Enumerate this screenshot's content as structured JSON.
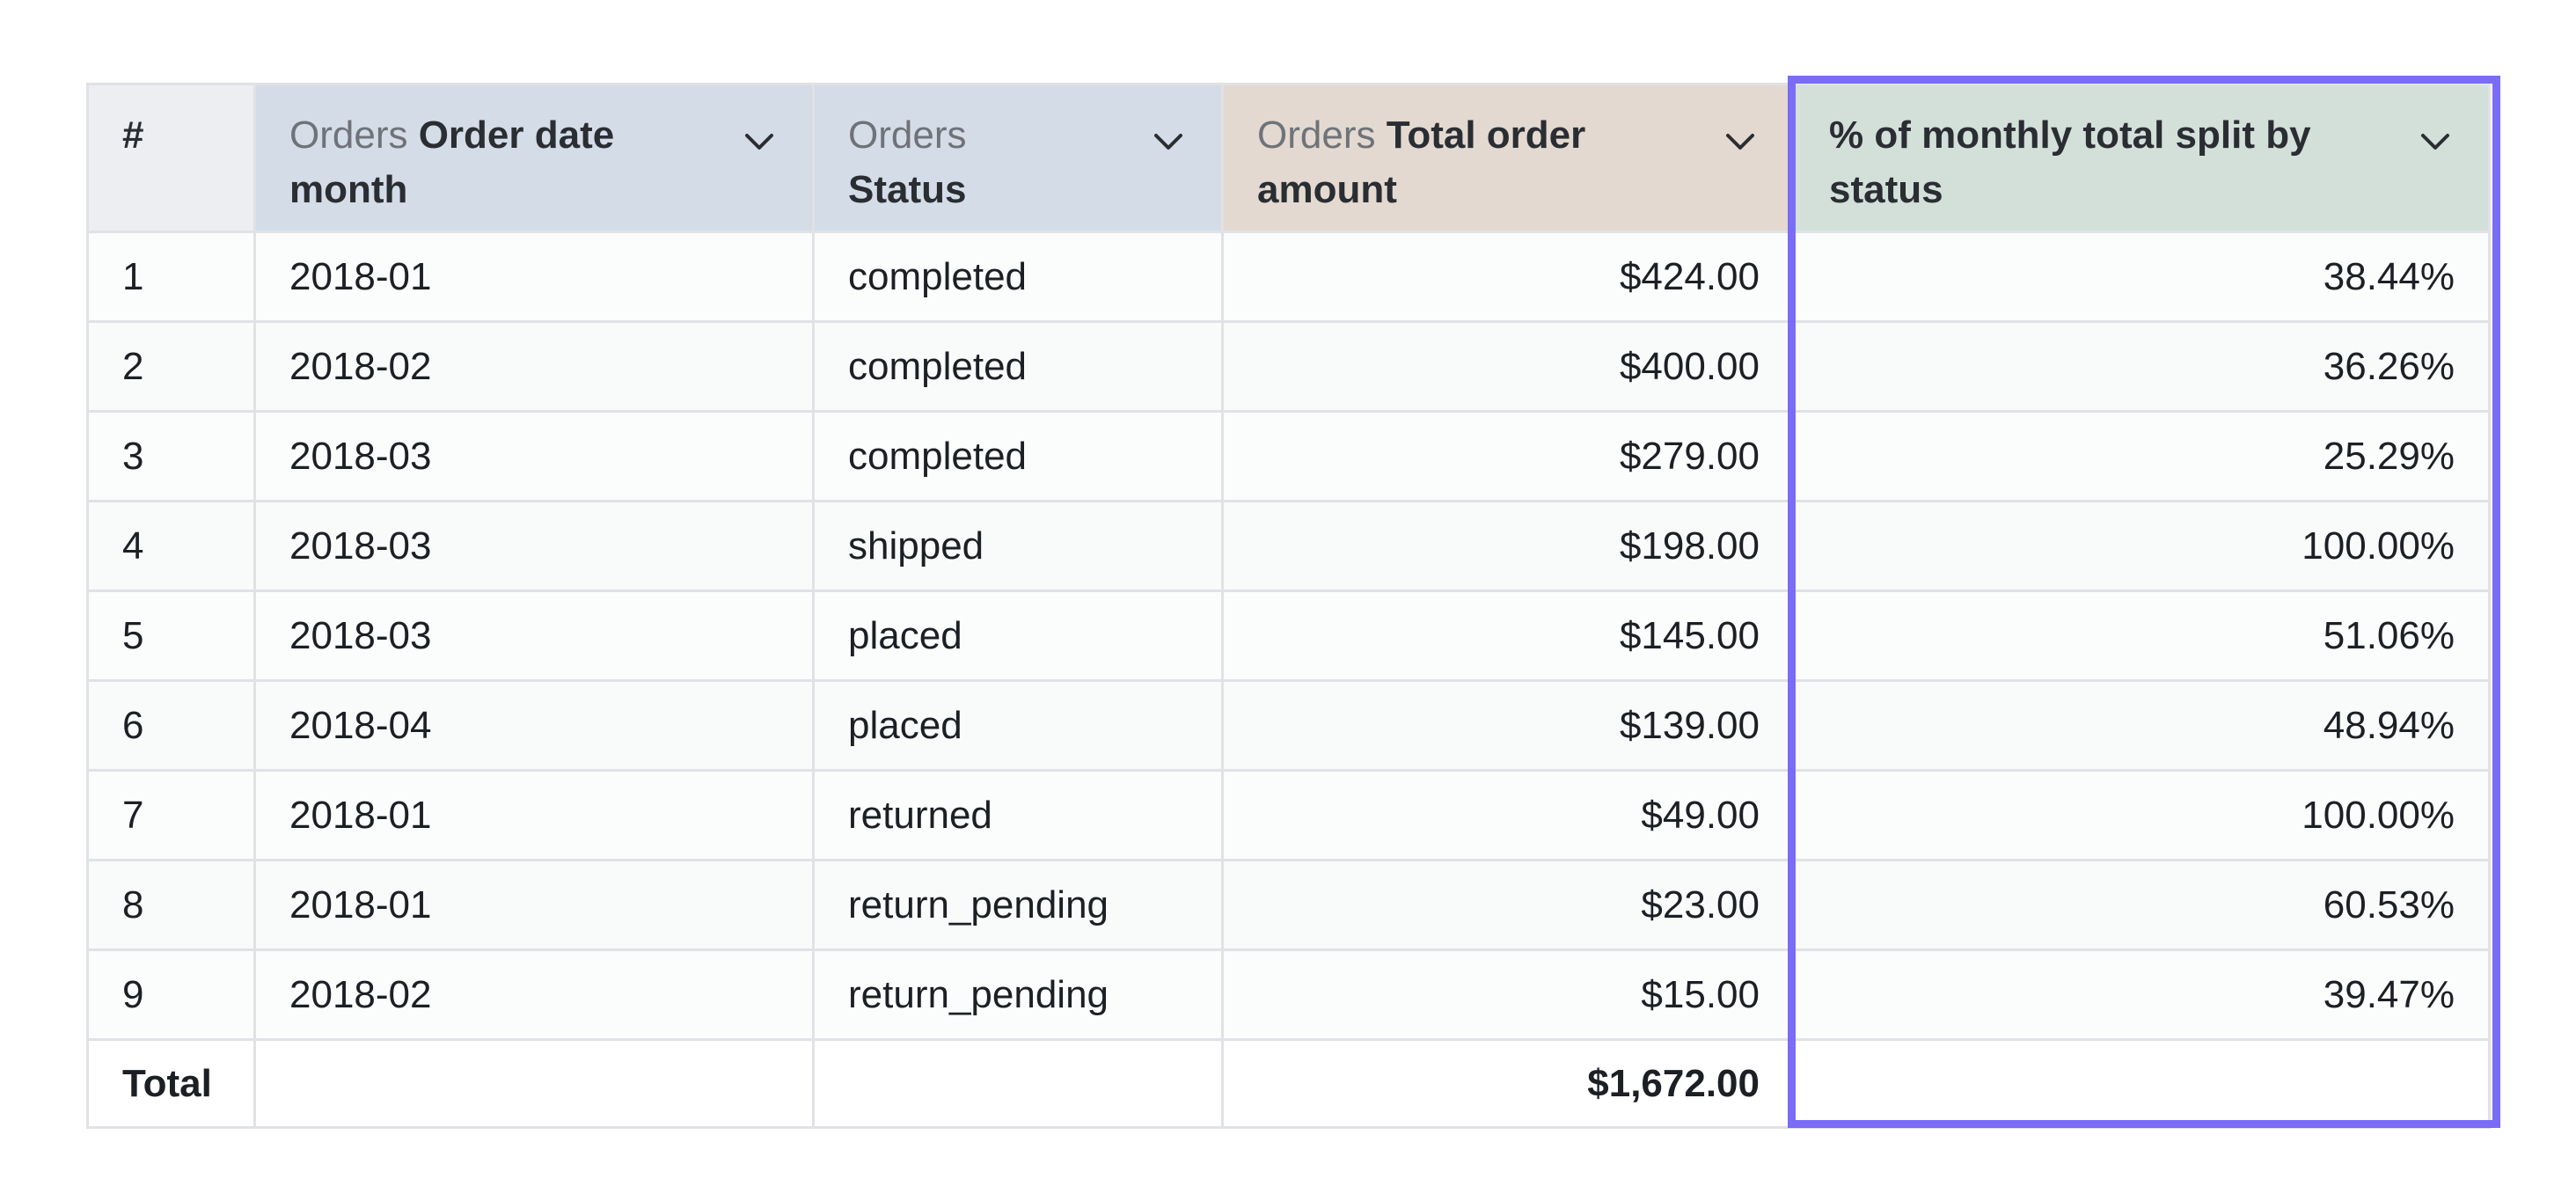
{
  "table": {
    "columns": [
      {
        "key": "index",
        "label_light": "",
        "label_bold": "#",
        "type": "index"
      },
      {
        "key": "order_date_month",
        "label_light": "Orders ",
        "label_bold": "Order date month",
        "type": "dimension"
      },
      {
        "key": "status",
        "label_light": "Orders",
        "label_bold": "Status",
        "type": "dimension"
      },
      {
        "key": "total_order_amount",
        "label_light": "Orders ",
        "label_bold": "Total order amount",
        "type": "measure"
      },
      {
        "key": "pct_monthly_total",
        "label_light": "",
        "label_bold": "% of monthly total split by status",
        "type": "calculation"
      }
    ],
    "rows": [
      {
        "index": "1",
        "order_date_month": "2018-01",
        "status": "completed",
        "total_order_amount": "$424.00",
        "pct_monthly_total": "38.44%"
      },
      {
        "index": "2",
        "order_date_month": "2018-02",
        "status": "completed",
        "total_order_amount": "$400.00",
        "pct_monthly_total": "36.26%"
      },
      {
        "index": "3",
        "order_date_month": "2018-03",
        "status": "completed",
        "total_order_amount": "$279.00",
        "pct_monthly_total": "25.29%"
      },
      {
        "index": "4",
        "order_date_month": "2018-03",
        "status": "shipped",
        "total_order_amount": "$198.00",
        "pct_monthly_total": "100.00%"
      },
      {
        "index": "5",
        "order_date_month": "2018-03",
        "status": "placed",
        "total_order_amount": "$145.00",
        "pct_monthly_total": "51.06%"
      },
      {
        "index": "6",
        "order_date_month": "2018-04",
        "status": "placed",
        "total_order_amount": "$139.00",
        "pct_monthly_total": "48.94%"
      },
      {
        "index": "7",
        "order_date_month": "2018-01",
        "status": "returned",
        "total_order_amount": "$49.00",
        "pct_monthly_total": "100.00%"
      },
      {
        "index": "8",
        "order_date_month": "2018-01",
        "status": "return_pending",
        "total_order_amount": "$23.00",
        "pct_monthly_total": "60.53%"
      },
      {
        "index": "9",
        "order_date_month": "2018-02",
        "status": "return_pending",
        "total_order_amount": "$15.00",
        "pct_monthly_total": "39.47%"
      }
    ],
    "totals": {
      "label": "Total",
      "total_order_amount": "$1,672.00"
    }
  },
  "icons": {
    "column_menu": "chevron-down-icon"
  },
  "colors": {
    "dimension_header": "#d4dce8",
    "measure_header": "#e3d9d0",
    "calculation_header": "#d3e0d9",
    "index_header": "#eceef1",
    "highlight": "#7b6cf6"
  }
}
